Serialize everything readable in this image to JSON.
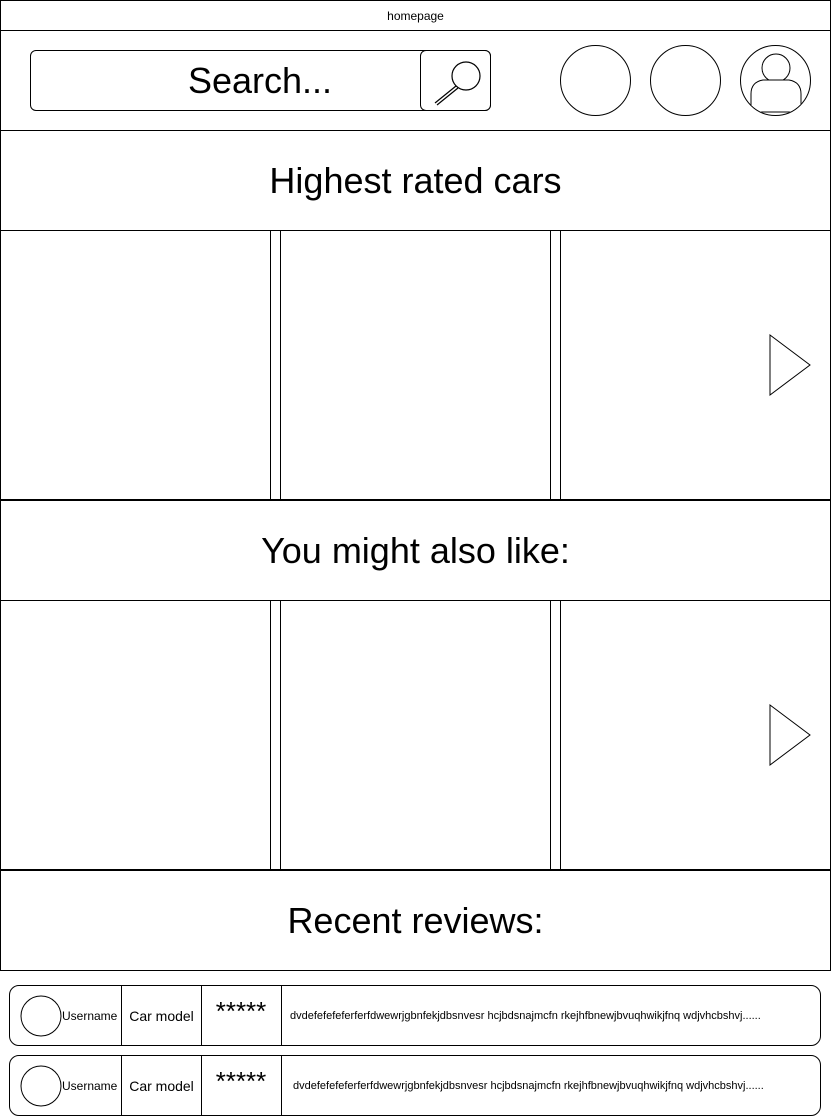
{
  "window": {
    "title": "homepage"
  },
  "header": {
    "search": {
      "placeholder": "Search..."
    },
    "icons": [
      "search-icon",
      "profile-icon"
    ]
  },
  "sections": {
    "highest_rated": {
      "title": "Highest rated cars"
    },
    "recommended": {
      "title": "You might also like:"
    },
    "recent_reviews": {
      "title": "Recent reviews:"
    }
  },
  "reviews": [
    {
      "username": "Username",
      "car_model": "Car model",
      "rating": "*****",
      "text": "dvdefefefeferferfdwewrjgbnfekjdbsnvesr hcjbdsnajmcfn rkejhfbnewjbvuqhwikjfnq wdjvhcbshvj......"
    },
    {
      "username": "Username",
      "car_model": "Car model",
      "rating": "*****",
      "text": "dvdefefefeferferfdwewrjgbnfekjdbsnvesr hcjbdsnajmcfn rkejhfbnewjbvuqhwikjfnq wdjvhcbshvj......"
    }
  ]
}
